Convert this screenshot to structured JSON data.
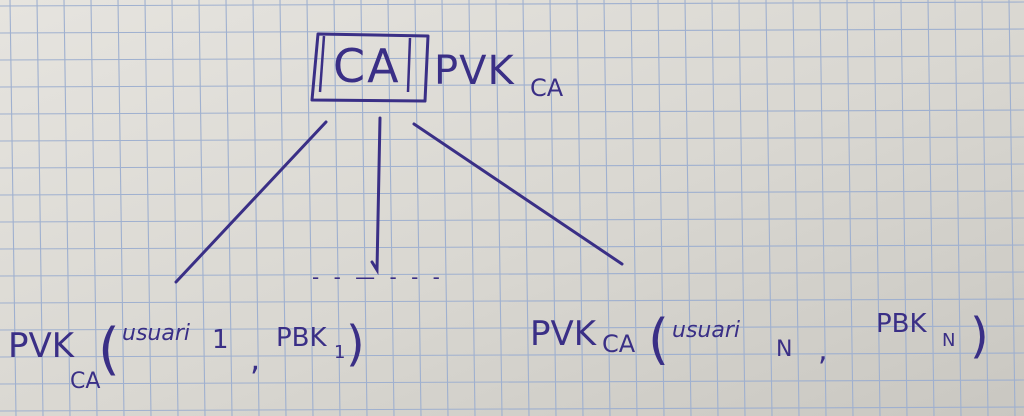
{
  "paper": {
    "color": "#dedcd7",
    "grid_color": "#9fb0cf",
    "ink_color": "#3a2f86"
  },
  "root": {
    "box_label": "CA",
    "key_label": "PVK",
    "key_subscript": "CA"
  },
  "children": [
    {
      "key_label": "PVK",
      "key_subscript": "CA",
      "open": "(",
      "user": "usuari",
      "user_index": "1",
      "sep": ",",
      "pbk": "PBK",
      "pbk_index": "1",
      "close": ")"
    },
    {
      "key_label": "PVK",
      "key_subscript": "CA",
      "open": "(",
      "user": "usuari",
      "user_index": "N",
      "sep": ",",
      "pbk": "PBK",
      "pbk_index": "N",
      "close": ")"
    }
  ],
  "ellipsis": "- - — - - -"
}
